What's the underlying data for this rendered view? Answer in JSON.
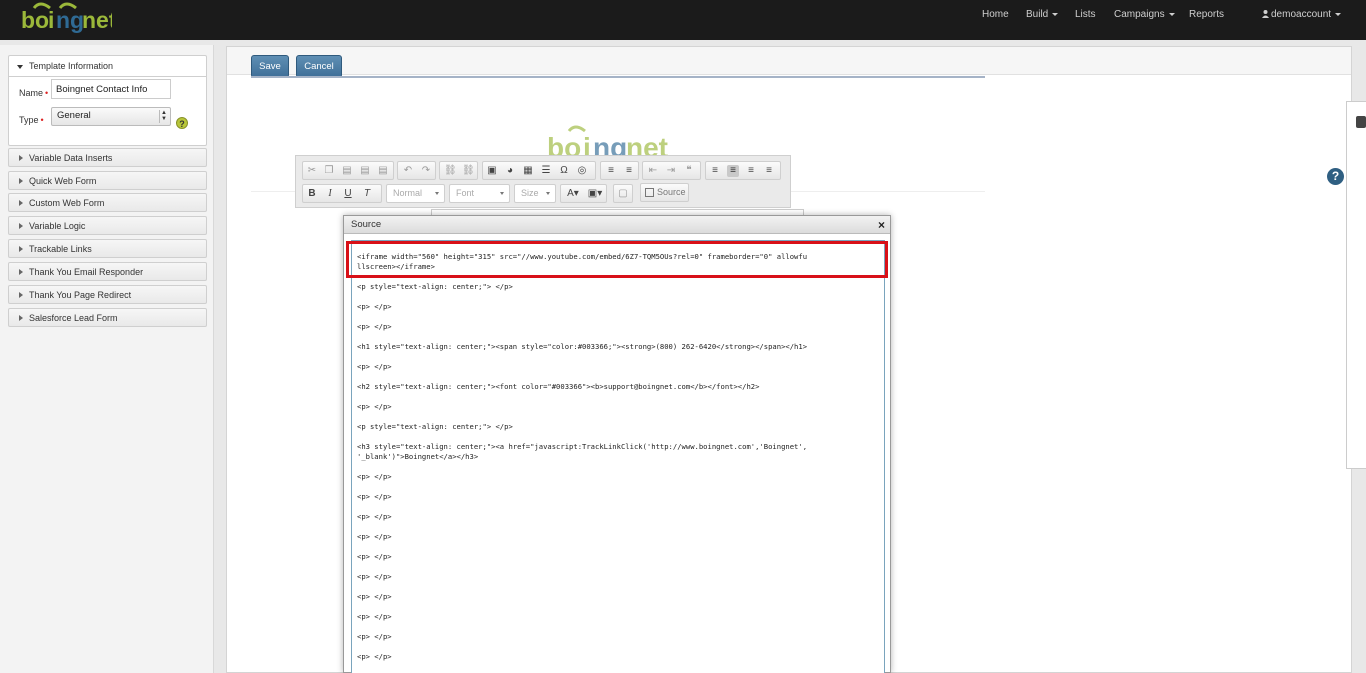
{
  "app": {
    "logo_text": "boingnet"
  },
  "nav": {
    "items": [
      {
        "label": "Home"
      },
      {
        "label": "Build",
        "dropdown": true
      },
      {
        "label": "Lists"
      },
      {
        "label": "Campaigns",
        "dropdown": true
      },
      {
        "label": "Reports"
      }
    ],
    "user": "demoaccount"
  },
  "sidebar": {
    "template_info": {
      "title": "Template Information",
      "name_label": "Name",
      "name_value": "Boingnet Contact Info",
      "type_label": "Type",
      "type_value": "General",
      "required_mark": "•",
      "help_glyph": "?"
    },
    "sections": [
      {
        "label": "Variable Data Inserts"
      },
      {
        "label": "Quick Web Form"
      },
      {
        "label": "Custom Web Form"
      },
      {
        "label": "Variable Logic"
      },
      {
        "label": "Trackable Links"
      },
      {
        "label": "Thank You Email Responder"
      },
      {
        "label": "Thank You Page Redirect"
      },
      {
        "label": "Salesforce Lead Form"
      }
    ]
  },
  "toolbar": {
    "save_label": "Save",
    "cancel_label": "Cancel"
  },
  "editor": {
    "format_combo": "Normal",
    "font_combo": "Font",
    "size_combo": "Size",
    "source_label": "Source"
  },
  "dialog": {
    "title": "Source",
    "close_glyph": "×",
    "lines": [
      "<iframe width=\"560\" height=\"315\" src=\"//www.youtube.com/embed/6Z7-TQM5OUs?rel=0\" frameborder=\"0\" allowfu",
      "llscreen></iframe>",
      "<p style=\"text-align: center;\"> </p>",
      "<p> </p>",
      "<p> </p>",
      "<h1 style=\"text-align: center;\"><span style=\"color:#003366;\"><strong>(800) 262-6420</strong></span></h1>",
      "<p> </p>",
      "<h2 style=\"text-align: center;\"><font color=\"#003366\"><b>support@boingnet.com</b></font></h2>",
      "<p> </p>",
      "<p style=\"text-align: center;\"> </p>",
      "<h3 style=\"text-align: center;\"><a href=\"javascript:TrackLinkClick('http://www.boingnet.com','Boingnet',",
      "'_blank')\">Boingnet</a></h3>",
      "<p> </p>",
      "<p> </p>",
      "<p> </p>",
      "<p> </p>",
      "<p> </p>",
      "<p> </p>",
      "<p> </p>",
      "<p> </p>",
      "<p> </p>",
      "<p> </p>"
    ]
  },
  "help_glyph": "?",
  "colors": {
    "navbar": "#1b1b1b",
    "primary_button": "#4a7aa3",
    "highlight": "#d81018",
    "logo_green": "#9bb83a",
    "logo_blue": "#2f6a94"
  }
}
